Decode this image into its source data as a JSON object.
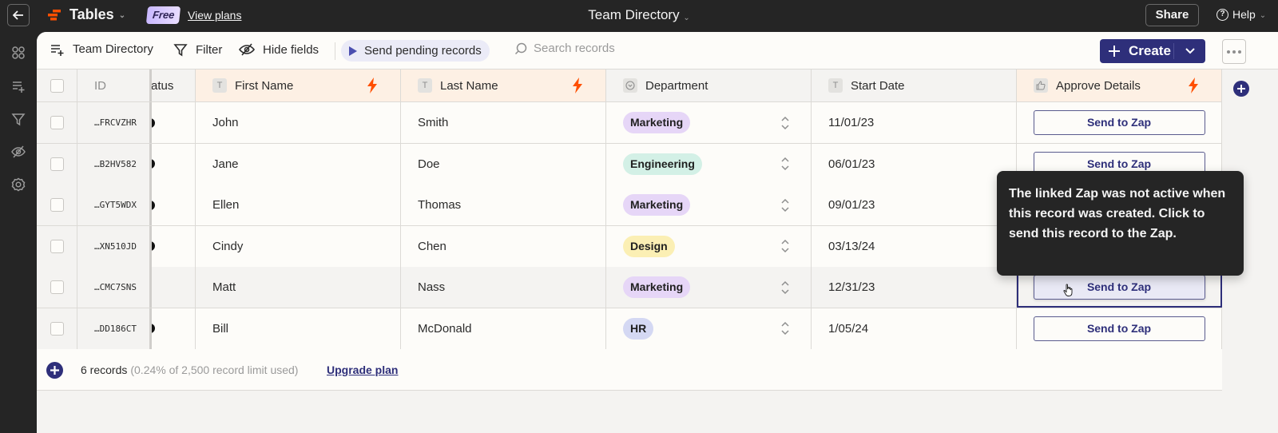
{
  "topbar": {
    "back_icon": "arrow-left-icon",
    "app_name": "Tables",
    "plan_badge": "Free",
    "view_plans": "View plans",
    "table_title": "Team Directory",
    "share": "Share",
    "help": "Help"
  },
  "rail": {
    "items": [
      {
        "icon": "apps-icon"
      },
      {
        "icon": "add-list-icon"
      },
      {
        "icon": "filter-icon"
      },
      {
        "icon": "eye-off-icon"
      },
      {
        "icon": "settings-icon"
      }
    ]
  },
  "toolbar": {
    "table_name": "Team Directory",
    "filter": "Filter",
    "hide_fields": "Hide fields",
    "send_pending": "Send pending records",
    "search_placeholder": "Search records",
    "create": "Create"
  },
  "table": {
    "columns": {
      "id": "ID",
      "status": "atus",
      "first_name": "First Name",
      "last_name": "Last Name",
      "department": "Department",
      "start_date": "Start Date",
      "approve": "Approve Details"
    },
    "type_icons": {
      "text": "T"
    },
    "button_label": "Send to Zap",
    "rows": [
      {
        "id": "…FRCVZHR",
        "first": "John",
        "last": "Smith",
        "dept": "Marketing",
        "dept_color": "#e6d6f7",
        "date": "11/01/23"
      },
      {
        "id": "…B2HV582",
        "first": "Jane",
        "last": "Doe",
        "dept": "Engineering",
        "dept_color": "#d3f0e6",
        "date": "06/01/23"
      },
      {
        "id": "…GYT5WDX",
        "first": "Ellen",
        "last": "Thomas",
        "dept": "Marketing",
        "dept_color": "#e6d6f7",
        "date": "09/01/23"
      },
      {
        "id": "…XN510JD",
        "first": "Cindy",
        "last": "Chen",
        "dept": "Design",
        "dept_color": "#fbefb4",
        "date": "03/13/24"
      },
      {
        "id": "…CMC7SNS",
        "first": "Matt",
        "last": "Nass",
        "dept": "Marketing",
        "dept_color": "#e6d6f7",
        "date": "12/31/23"
      },
      {
        "id": "…DD186CT",
        "first": "Bill",
        "last": "McDonald",
        "dept": "HR",
        "dept_color": "#d4d8f3",
        "date": "1/05/24"
      }
    ]
  },
  "footer": {
    "count": "6 records",
    "limit": "(0.24% of 2,500 record limit used)",
    "upgrade": "Upgrade plan"
  },
  "tooltip": {
    "text": "The linked Zap was not active when this record was created. Click to send this record to the Zap."
  },
  "colors": {
    "accent": "#2e2f7a",
    "zap_orange": "#ff4f00",
    "topbar_bg": "#252525"
  }
}
